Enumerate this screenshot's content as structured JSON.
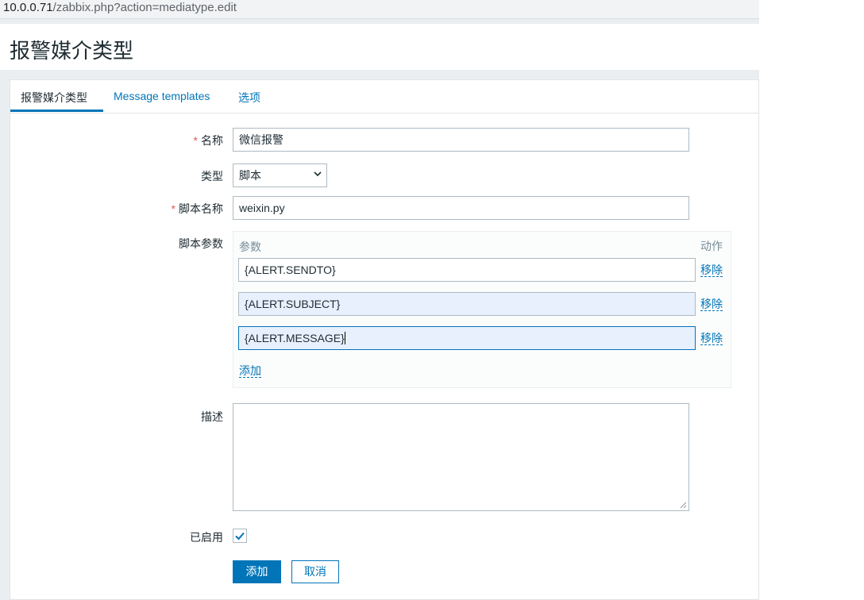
{
  "browser": {
    "url_host": "10.0.0.71",
    "url_path": "/zabbix.php?action=mediatype.edit"
  },
  "page": {
    "title": "报警媒介类型"
  },
  "tabs": [
    {
      "label": "报警媒介类型",
      "active": true
    },
    {
      "label": "Message templates",
      "active": false
    },
    {
      "label": "选项",
      "active": false
    }
  ],
  "form": {
    "required_mark": "*",
    "name": {
      "label": "名称",
      "value": "微信报警"
    },
    "type": {
      "label": "类型",
      "value": "脚本"
    },
    "script_name": {
      "label": "脚本名称",
      "value": "weixin.py"
    },
    "script_params": {
      "label": "脚本参数",
      "col_param": "参数",
      "col_action": "动作",
      "rows": [
        {
          "value": "{ALERT.SENDTO}",
          "action": "移除"
        },
        {
          "value": "{ALERT.SUBJECT}",
          "action": "移除"
        },
        {
          "value": "{ALERT.MESSAGE}",
          "action": "移除"
        }
      ],
      "add_label": "添加"
    },
    "description": {
      "label": "描述",
      "value": ""
    },
    "enabled": {
      "label": "已启用",
      "checked": true
    },
    "buttons": {
      "add": "添加",
      "cancel": "取消"
    }
  },
  "colors": {
    "accent": "#0275b8",
    "required": "#e45959",
    "field_highlight": "#e8f0fe"
  }
}
